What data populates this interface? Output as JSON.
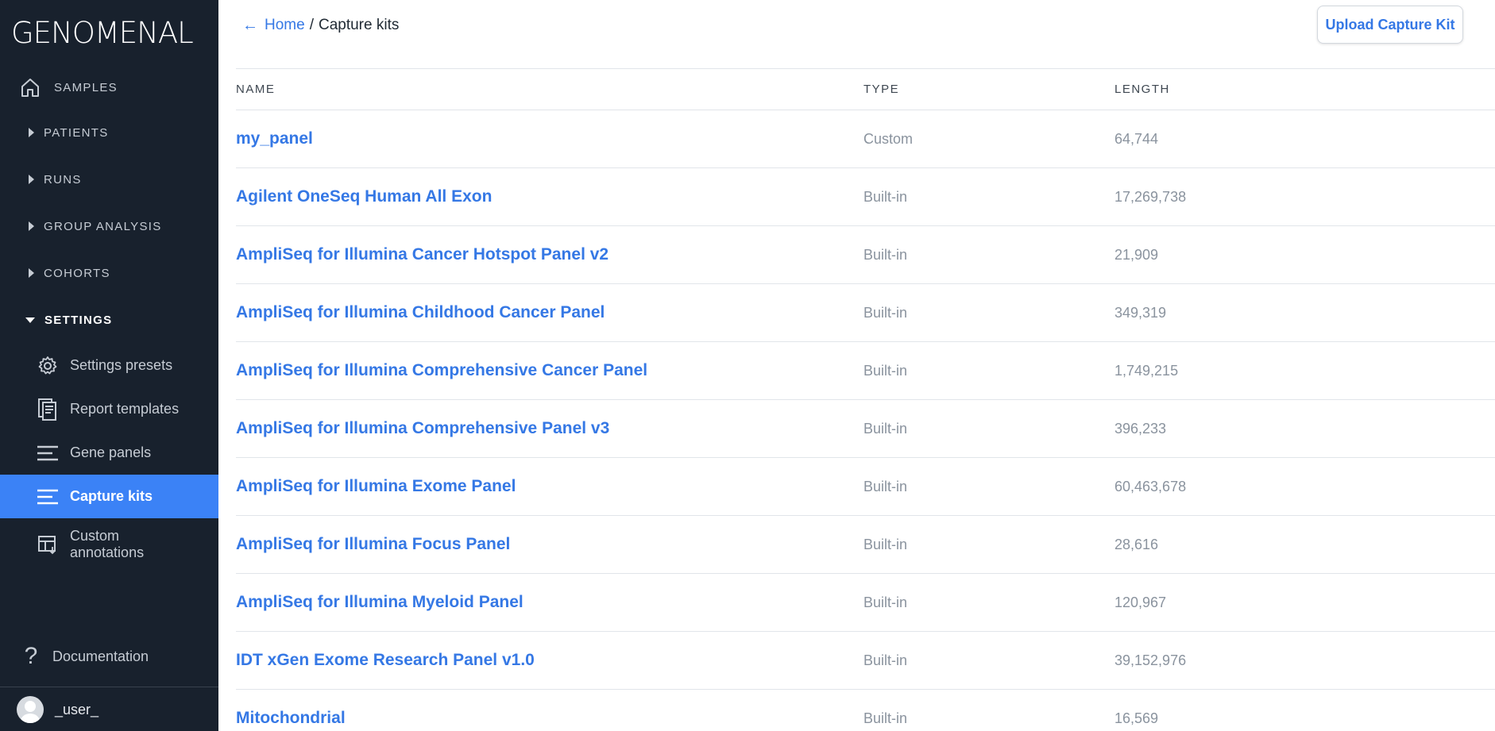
{
  "app": {
    "logo": "GENOMENAL"
  },
  "sidebar": {
    "samples_label": "SAMPLES",
    "nav": [
      {
        "label": "PATIENTS"
      },
      {
        "label": "RUNS"
      },
      {
        "label": "GROUP ANALYSIS"
      },
      {
        "label": "COHORTS"
      },
      {
        "label": "SETTINGS"
      }
    ],
    "settings_items": [
      {
        "label": "Settings presets",
        "icon": "gear-icon"
      },
      {
        "label": "Report templates",
        "icon": "report-icon"
      },
      {
        "label": "Gene panels",
        "icon": "list-icon"
      },
      {
        "label": "Capture kits",
        "icon": "list-icon"
      },
      {
        "label": "Custom annotations",
        "icon": "table-icon"
      }
    ],
    "documentation_label": "Documentation",
    "user_label": "_user_"
  },
  "header": {
    "breadcrumb_home": "Home",
    "breadcrumb_sep": "/",
    "breadcrumb_current": "Capture kits",
    "upload_button": "Upload Capture Kit"
  },
  "table": {
    "columns": [
      "NAME",
      "TYPE",
      "LENGTH"
    ],
    "rows": [
      {
        "name": "my_panel",
        "type": "Custom",
        "length": "64,744"
      },
      {
        "name": "Agilent OneSeq Human All Exon",
        "type": "Built-in",
        "length": "17,269,738"
      },
      {
        "name": "AmpliSeq for Illumina Cancer Hotspot Panel v2",
        "type": "Built-in",
        "length": "21,909"
      },
      {
        "name": "AmpliSeq for Illumina Childhood Cancer Panel",
        "type": "Built-in",
        "length": "349,319"
      },
      {
        "name": "AmpliSeq for Illumina Comprehensive Cancer Panel",
        "type": "Built-in",
        "length": "1,749,215"
      },
      {
        "name": "AmpliSeq for Illumina Comprehensive Panel v3",
        "type": "Built-in",
        "length": "396,233"
      },
      {
        "name": "AmpliSeq for Illumina Exome Panel",
        "type": "Built-in",
        "length": "60,463,678"
      },
      {
        "name": "AmpliSeq for Illumina Focus Panel",
        "type": "Built-in",
        "length": "28,616"
      },
      {
        "name": "AmpliSeq for Illumina Myeloid Panel",
        "type": "Built-in",
        "length": "120,967"
      },
      {
        "name": "IDT xGen Exome Research Panel v1.0",
        "type": "Built-in",
        "length": "39,152,976"
      },
      {
        "name": "Mitochondrial",
        "type": "Built-in",
        "length": "16,569"
      }
    ]
  },
  "colors": {
    "sidebar_bg": "#18212d",
    "accent": "#3578e5",
    "active_bg": "#3b82f6"
  }
}
